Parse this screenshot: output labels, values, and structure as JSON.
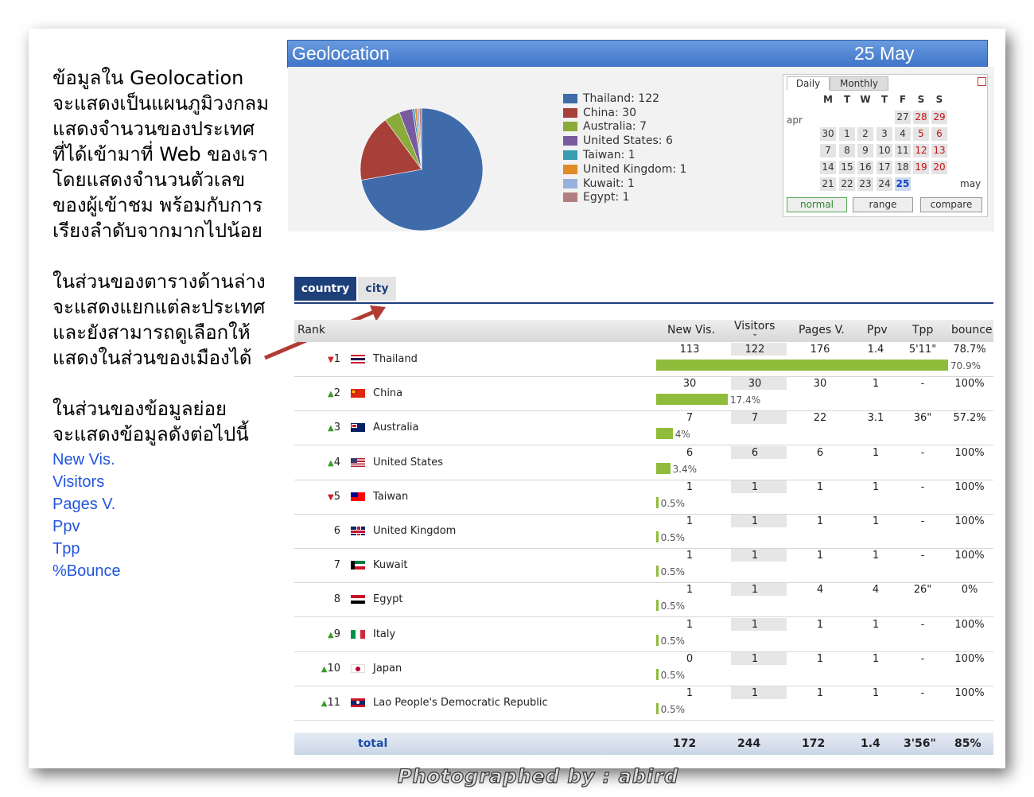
{
  "left_text": {
    "paragraph1": [
      "ข้อมูลใน Geolocation",
      "จะแสดงเป็นแผนภูมิวงกลม",
      "แสดงจำนวนของประเทศ",
      "ที่ได้เข้ามาที่ Web ของเรา",
      "โดยแสดงจำนวนตัวเลข",
      "ของผู้เข้าชม พร้อมกับการ",
      "เรียงลำดับจากมากไปน้อย"
    ],
    "paragraph2": [
      "ในส่วนของตารางด้านล่าง",
      "จะแสดงแยกแต่ละประเทศ",
      "และยังสามารถดูเลือกให้",
      "แสดงในส่วนของเมืองได้"
    ],
    "paragraph3": [
      "ในส่วนของข้อมูลย่อย",
      "จะแสดงข้อมูลดังต่อไปนี้"
    ],
    "metrics": [
      "New Vis.",
      "Visitors",
      "Pages V.",
      "Ppv",
      "Tpp",
      "%Bounce"
    ]
  },
  "geo": {
    "title": "Geolocation",
    "date": "25 May",
    "legend": [
      {
        "label": "Thailand: 122",
        "color": "#3f6bab"
      },
      {
        "label": "China: 30",
        "color": "#a8403a"
      },
      {
        "label": "Australia: 7",
        "color": "#8aab3a"
      },
      {
        "label": "United States: 6",
        "color": "#7a5a9e"
      },
      {
        "label": "Taiwan: 1",
        "color": "#3a9cb0"
      },
      {
        "label": "United Kingdom: 1",
        "color": "#e08a2a"
      },
      {
        "label": "Kuwait: 1",
        "color": "#9ab0dc"
      },
      {
        "label": "Egypt: 1",
        "color": "#b08080"
      }
    ],
    "pie_values": [
      122,
      30,
      7,
      6,
      1,
      1,
      1,
      1
    ]
  },
  "calendar": {
    "tab_daily": "Daily",
    "tab_monthly": "Monthly",
    "day_headers": [
      "M",
      "T",
      "W",
      "T",
      "F",
      "S",
      "S"
    ],
    "prev_month": "apr",
    "next_month": "may",
    "weeks": [
      [
        "",
        "",
        "",
        "",
        "27",
        "28",
        "29"
      ],
      [
        "30",
        "1",
        "2",
        "3",
        "4",
        "5",
        "6"
      ],
      [
        "7",
        "8",
        "9",
        "10",
        "11",
        "12",
        "13"
      ],
      [
        "14",
        "15",
        "16",
        "17",
        "18",
        "19",
        "20"
      ],
      [
        "21",
        "22",
        "23",
        "24",
        "25",
        "",
        ""
      ]
    ],
    "btn_normal": "normal",
    "btn_range": "range",
    "btn_compare": "compare"
  },
  "tabs": {
    "country": "country",
    "city": "city"
  },
  "table": {
    "headers": {
      "rank": "Rank",
      "newvis": "New Vis.",
      "visitors": "Visitors",
      "pages": "Pages V.",
      "ppv": "Ppv",
      "tpp": "Tpp",
      "bounce": "bounce"
    },
    "rows": [
      {
        "trend": "down",
        "rank": "1",
        "country": "Thailand",
        "newvis": "113",
        "visitors": "122",
        "pages": "176",
        "ppv": "1.4",
        "tpp": "5'11\"",
        "bounce": "78.7%",
        "pct_label": "70.9%",
        "pct": 70.9
      },
      {
        "trend": "up",
        "rank": "2",
        "country": "China",
        "newvis": "30",
        "visitors": "30",
        "pages": "30",
        "ppv": "1",
        "tpp": "-",
        "bounce": "100%",
        "pct_label": "17.4%",
        "pct": 17.4
      },
      {
        "trend": "up",
        "rank": "3",
        "country": "Australia",
        "newvis": "7",
        "visitors": "7",
        "pages": "22",
        "ppv": "3.1",
        "tpp": "36\"",
        "bounce": "57.2%",
        "pct_label": "4%",
        "pct": 4
      },
      {
        "trend": "up",
        "rank": "4",
        "country": "United States",
        "newvis": "6",
        "visitors": "6",
        "pages": "6",
        "ppv": "1",
        "tpp": "-",
        "bounce": "100%",
        "pct_label": "3.4%",
        "pct": 3.4
      },
      {
        "trend": "down",
        "rank": "5",
        "country": "Taiwan",
        "newvis": "1",
        "visitors": "1",
        "pages": "1",
        "ppv": "1",
        "tpp": "-",
        "bounce": "100%",
        "pct_label": "0.5%",
        "pct": 0.5
      },
      {
        "trend": "",
        "rank": "6",
        "country": "United Kingdom",
        "newvis": "1",
        "visitors": "1",
        "pages": "1",
        "ppv": "1",
        "tpp": "-",
        "bounce": "100%",
        "pct_label": "0.5%",
        "pct": 0.5
      },
      {
        "trend": "",
        "rank": "7",
        "country": "Kuwait",
        "newvis": "1",
        "visitors": "1",
        "pages": "1",
        "ppv": "1",
        "tpp": "-",
        "bounce": "100%",
        "pct_label": "0.5%",
        "pct": 0.5
      },
      {
        "trend": "",
        "rank": "8",
        "country": "Egypt",
        "newvis": "1",
        "visitors": "1",
        "pages": "4",
        "ppv": "4",
        "tpp": "26\"",
        "bounce": "0%",
        "pct_label": "0.5%",
        "pct": 0.5
      },
      {
        "trend": "up",
        "rank": "9",
        "country": "Italy",
        "newvis": "1",
        "visitors": "1",
        "pages": "1",
        "ppv": "1",
        "tpp": "-",
        "bounce": "100%",
        "pct_label": "0.5%",
        "pct": 0.5
      },
      {
        "trend": "up",
        "rank": "10",
        "country": "Japan",
        "newvis": "0",
        "visitors": "1",
        "pages": "1",
        "ppv": "1",
        "tpp": "-",
        "bounce": "100%",
        "pct_label": "0.5%",
        "pct": 0.5
      },
      {
        "trend": "up",
        "rank": "11",
        "country": "Lao People's Democratic Republic",
        "newvis": "1",
        "visitors": "1",
        "pages": "1",
        "ppv": "1",
        "tpp": "-",
        "bounce": "100%",
        "pct_label": "0.5%",
        "pct": 0.5
      }
    ],
    "total": {
      "label": "total",
      "newvis": "172",
      "visitors": "244",
      "pages": "172",
      "ppv": "1.4",
      "tpp": "3'56\"",
      "bounce": "85%"
    }
  },
  "watermark": "Photographed by : abird",
  "flag_colors": {
    "Thailand": [
      "#d21034",
      "#ffffff",
      "#241d4f"
    ],
    "China": [
      "#de2910",
      "#ffde00"
    ],
    "Australia": [
      "#012169",
      "#ffffff"
    ],
    "United States": [
      "#b22234",
      "#3c3b6e"
    ],
    "Taiwan": [
      "#fe0000",
      "#000095"
    ],
    "United Kingdom": [
      "#012169",
      "#c8102e"
    ],
    "Kuwait": [
      "#007a3d",
      "#ce1126",
      "#000000"
    ],
    "Egypt": [
      "#ce1126",
      "#ffffff",
      "#000000"
    ],
    "Italy": [
      "#009246",
      "#ffffff",
      "#ce2b37"
    ],
    "Japan": [
      "#ffffff",
      "#bc002d"
    ],
    "Lao People's Democratic Republic": [
      "#ce1126",
      "#002868",
      "#ffffff"
    ]
  }
}
